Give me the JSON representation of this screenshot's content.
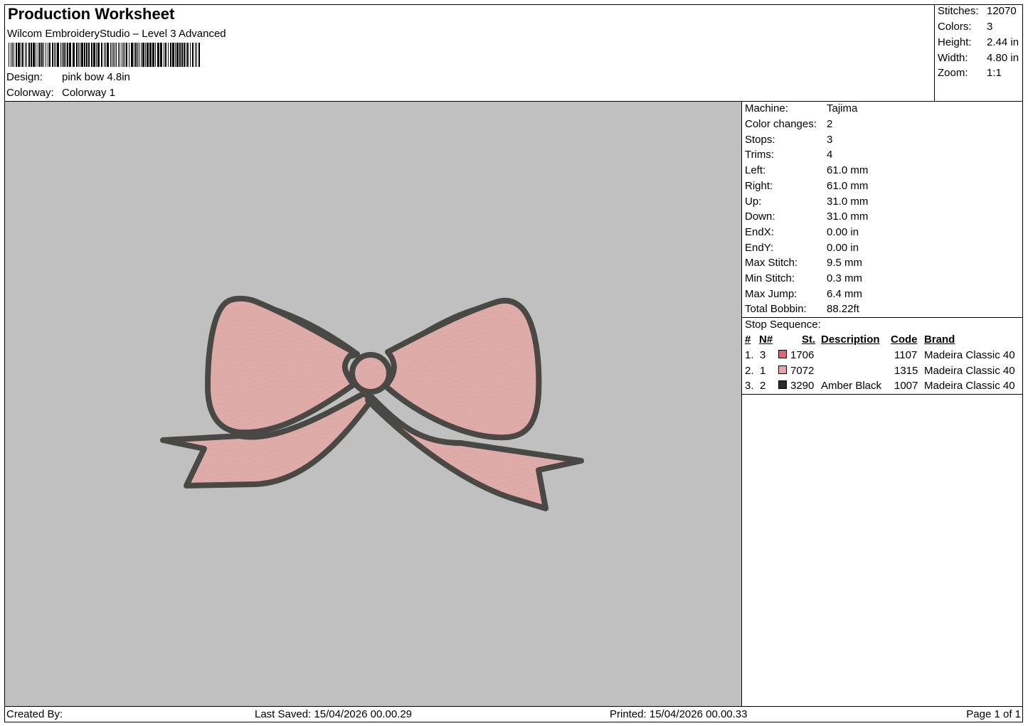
{
  "header": {
    "title": "Production Worksheet",
    "subtitle": "Wilcom EmbroideryStudio – Level 3 Advanced",
    "design_label": "Design:",
    "design_value": "pink bow 4.8in",
    "colorway_label": "Colorway:",
    "colorway_value": "Colorway 1"
  },
  "stats": [
    {
      "label": "Stitches:",
      "value": "12070"
    },
    {
      "label": "Colors:",
      "value": "3"
    },
    {
      "label": "Height:",
      "value": "2.44 in"
    },
    {
      "label": "Width:",
      "value": "4.80 in"
    },
    {
      "label": "Zoom:",
      "value": "1:1"
    }
  ],
  "properties": [
    {
      "label": "Machine:",
      "value": "Tajima"
    },
    {
      "label": "Color changes:",
      "value": "2"
    },
    {
      "label": "Stops:",
      "value": "3"
    },
    {
      "label": "Trims:",
      "value": "4"
    },
    {
      "label": "Left:",
      "value": "61.0 mm"
    },
    {
      "label": "Right:",
      "value": "61.0 mm"
    },
    {
      "label": "Up:",
      "value": "31.0 mm"
    },
    {
      "label": "Down:",
      "value": "31.0 mm"
    },
    {
      "label": "EndX:",
      "value": "0.00 in"
    },
    {
      "label": "EndY:",
      "value": "0.00 in"
    },
    {
      "label": "Max Stitch:",
      "value": "9.5 mm"
    },
    {
      "label": "Min Stitch:",
      "value": "0.3 mm"
    },
    {
      "label": "Max Jump:",
      "value": "6.4 mm"
    },
    {
      "label": "Total Bobbin:",
      "value": "88.22ft"
    }
  ],
  "stop_sequence": {
    "title": "Stop Sequence:",
    "columns": [
      "#",
      "N#",
      "St.",
      "Description",
      "Code",
      "Brand"
    ],
    "rows": [
      {
        "index": "1.",
        "n": "3",
        "color": "#e06676",
        "st": "1706",
        "description": "",
        "code": "1107",
        "brand": "Madeira Classic 40"
      },
      {
        "index": "2.",
        "n": "1",
        "color": "#e9a5a5",
        "st": "7072",
        "description": "",
        "code": "1315",
        "brand": "Madeira Classic 40"
      },
      {
        "index": "3.",
        "n": "2",
        "color": "#2b2b2b",
        "st": "3290",
        "description": "Amber Black",
        "code": "1007",
        "brand": "Madeira Classic 40"
      }
    ]
  },
  "footer": {
    "created_by": "Created By:",
    "last_saved": "Last Saved: 15/04/2026 00.00.29",
    "printed": "Printed: 15/04/2026 00.00.33",
    "page": "Page 1 of 1"
  },
  "colors": {
    "canvas_background": "#c0c0c0",
    "bow_inner_loop": "#d9797d",
    "bow_body": "#ddaaa7",
    "bow_outline": "#4a4845"
  }
}
